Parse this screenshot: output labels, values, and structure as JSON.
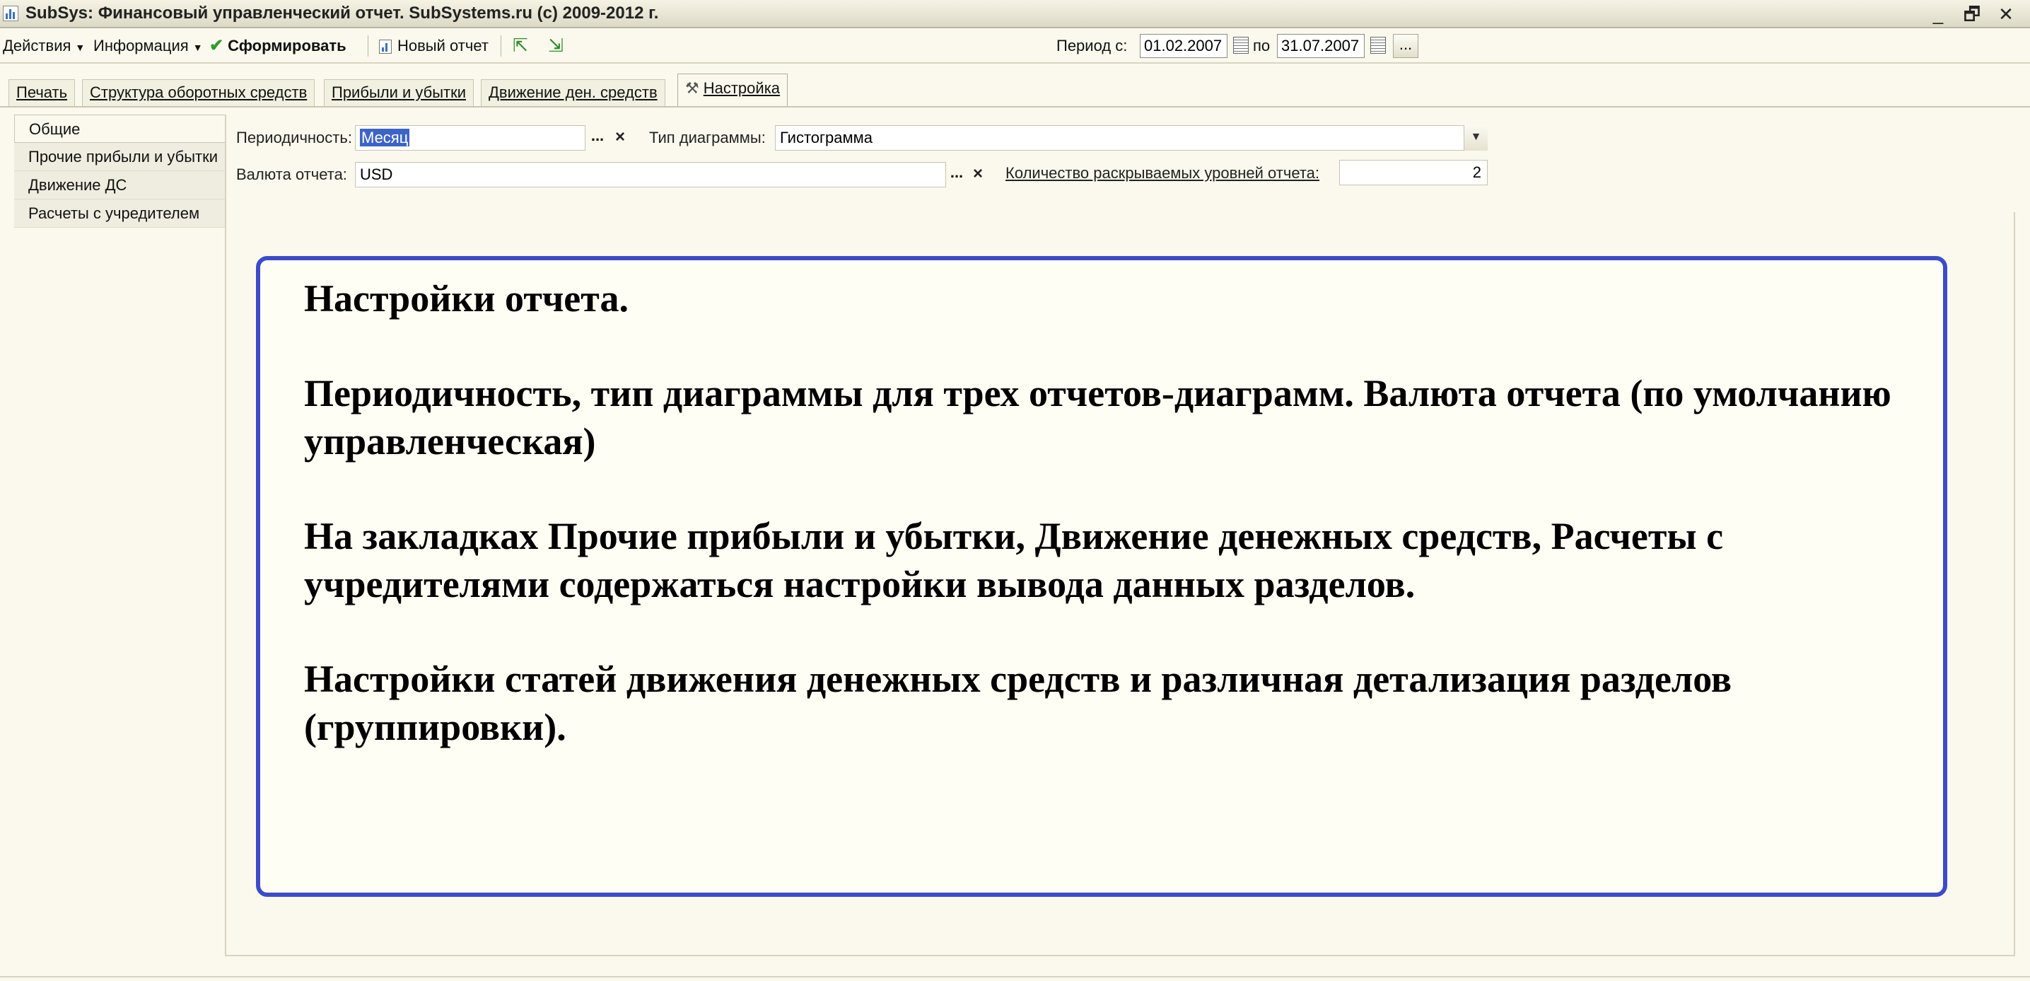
{
  "window": {
    "title": "SubSys: Финансовый управленческий отчет. SubSystems.ru (c) 2009-2012 г.",
    "controls": [
      "_",
      "🗗",
      "✕"
    ]
  },
  "toolbar": {
    "actions_label": "Действия",
    "info_label": "Информация",
    "generate_label": "Сформировать",
    "new_report_label": "Новый отчет",
    "period_from_label": "Период с:",
    "period_from_value": "01.02.2007",
    "period_to_label": "по",
    "period_to_value": "31.07.2007",
    "more_label": "..."
  },
  "tabs": [
    {
      "label": "Печать",
      "active": false
    },
    {
      "label": "Структура оборотных средств",
      "active": false
    },
    {
      "label": "Прибыли и убытки",
      "active": false
    },
    {
      "label": "Движение ден. средств",
      "active": false
    },
    {
      "label": "Настройка",
      "active": true
    }
  ],
  "sidebar": {
    "items": [
      {
        "label": "Общие",
        "selected": true
      },
      {
        "label": "Прочие прибыли и убытки",
        "selected": false
      },
      {
        "label": "Движение ДС",
        "selected": false
      },
      {
        "label": "Расчеты с учредителем",
        "selected": false
      }
    ]
  },
  "form": {
    "periodicity_label": "Периодичность:",
    "periodicity_value": "Месяц",
    "chart_type_label": "Тип диаграммы:",
    "chart_type_value": "Гистограмма",
    "currency_label": "Валюта отчета:",
    "currency_value": "USD",
    "levels_label": "Количество раскрываемых уровней отчета:",
    "levels_value": "2",
    "dots": "...",
    "clear": "×"
  },
  "note": {
    "p1": "Настройки отчета.",
    "p2": "Периодичность, тип диаграммы для трех отчетов-диаграмм. Валюта отчета (по умолчанию управленческая)",
    "p3": "На закладках Прочие прибыли и убытки, Движение денежных средств, Расчеты с учредителями содержаться настройки вывода данных разделов.",
    "p4": "Настройки статей движения денежных средств и различная детализация разделов (группировки)."
  },
  "colors": {
    "background": "#fbf9ed",
    "note_border": "#3c4cc8",
    "selection": "#3c64c8",
    "check": "#2e9b2e"
  }
}
